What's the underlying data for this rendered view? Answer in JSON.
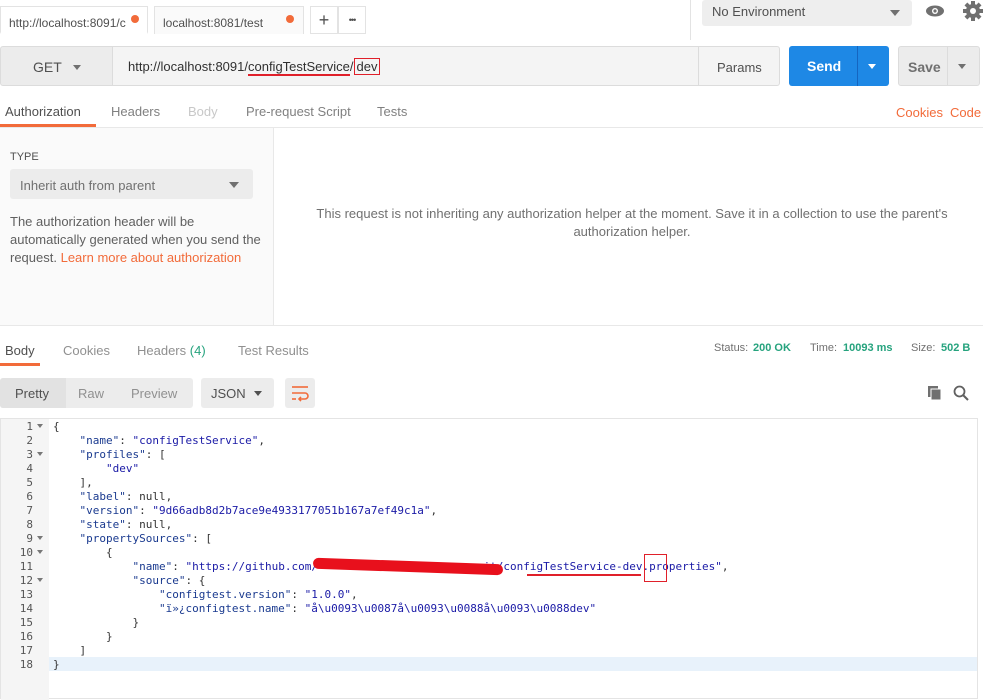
{
  "tabs": [
    {
      "label": "http://localhost:8091/c",
      "active": true
    },
    {
      "label": "localhost:8081/test",
      "active": false
    }
  ],
  "tabbar": {
    "add_icon": "+",
    "more_icon": "•••"
  },
  "environment": {
    "selected": "No Environment"
  },
  "request": {
    "method": "GET",
    "url_prefix": "http://localhost:8091/",
    "url_service": "configTestService",
    "url_slash": "/",
    "url_profile": "dev",
    "params_label": "Params",
    "send_label": "Send",
    "save_label": "Save"
  },
  "request_tabs": [
    "Authorization",
    "Headers",
    "Body",
    "Pre-request Script",
    "Tests"
  ],
  "request_links": {
    "cookies": "Cookies",
    "code": "Code"
  },
  "auth": {
    "type_label": "TYPE",
    "type_value": "Inherit auth from parent",
    "description": "The authorization header will be automatically generated when you send the request. ",
    "learn_more": "Learn more about authorization",
    "message": "This request is not inheriting any authorization helper at the moment. Save it in a collection to use the parent's authorization helper."
  },
  "response_tabs": {
    "body": "Body",
    "cookies": "Cookies",
    "headers": "Headers",
    "headers_count": "(4)",
    "tests": "Test Results"
  },
  "status": {
    "status_label": "Status:",
    "status_value": "200 OK",
    "time_label": "Time:",
    "time_value": "10093 ms",
    "size_label": "Size:",
    "size_value": "502 B"
  },
  "view_modes": {
    "pretty": "Pretty",
    "raw": "Raw",
    "preview": "Preview",
    "format": "JSON"
  },
  "colors": {
    "accent": "#f26b3a",
    "send": "#1e88e5",
    "success": "#26a37e",
    "annotation": "#e0202a"
  },
  "code_lines": [
    {
      "n": "1",
      "text": "{"
    },
    {
      "n": "2",
      "text": "    \"name\": \"configTestService\","
    },
    {
      "n": "3",
      "text": "    \"profiles\": ["
    },
    {
      "n": "4",
      "text": "        \"dev\""
    },
    {
      "n": "5",
      "text": "    ],"
    },
    {
      "n": "6",
      "text": "    \"label\": null,"
    },
    {
      "n": "7",
      "text": "    \"version\": \"9d66adb8d2b7ace9e4933177051b167a7ef49c1a\","
    },
    {
      "n": "8",
      "text": "    \"state\": null,"
    },
    {
      "n": "9",
      "text": "    \"propertySources\": ["
    },
    {
      "n": "10",
      "text": "        {"
    },
    {
      "n": "11",
      "text": "            \"name\": \"https://github.com/                       .git/configTestService-dev.properties\","
    },
    {
      "n": "12",
      "text": "            \"source\": {"
    },
    {
      "n": "13",
      "text": "                \"configtest.version\": \"1.0.0\","
    },
    {
      "n": "14",
      "text": "                \"ï»¿configtest.name\": \"å\\u0093\\u0087å\\u0093\\u0088å\\u0093\\u0088dev\""
    },
    {
      "n": "15",
      "text": "            }"
    },
    {
      "n": "16",
      "text": "        }"
    },
    {
      "n": "17",
      "text": "    ]"
    },
    {
      "n": "18",
      "text": "}"
    }
  ]
}
